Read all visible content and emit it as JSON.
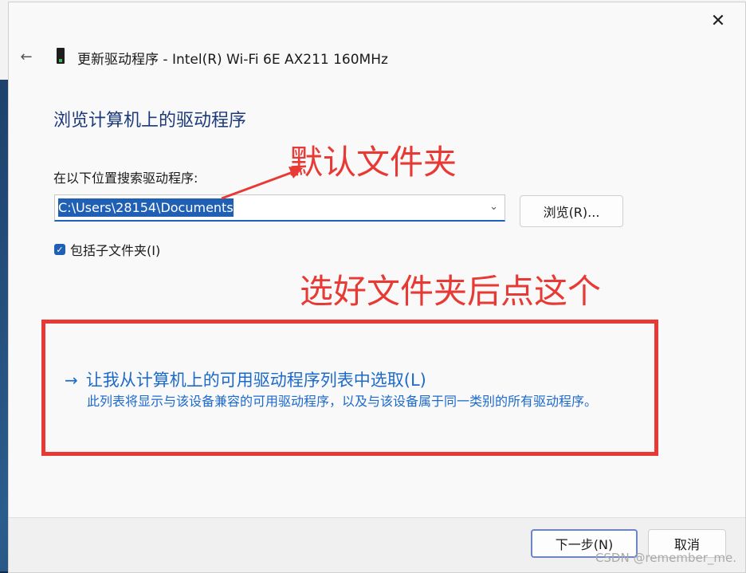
{
  "window": {
    "title": "更新驱动程序 - Intel(R) Wi-Fi 6E AX211 160MHz",
    "close_symbol": "✕",
    "back_symbol": "←"
  },
  "main": {
    "section_title": "浏览计算机上的驱动程序",
    "search_label": "在以下位置搜索驱动程序:",
    "path_value": "C:\\Users\\28154\\Documents",
    "browse_button": "浏览(R)...",
    "include_subfolders": {
      "label": "包括子文件夹(I)",
      "checked": true
    },
    "pick_from_list": {
      "arrow": "→",
      "label": "让我从计算机上的可用驱动程序列表中选取(L)",
      "description": "此列表将显示与该设备兼容的可用驱动程序，以及与该设备属于同一类别的所有驱动程序。"
    }
  },
  "annotations": {
    "default_folder": "默认文件夹",
    "after_select": "选好文件夹后点这个"
  },
  "footer": {
    "next_button": "下一步(N)",
    "cancel_button": "取消"
  },
  "watermark": "CSDN @remember_me.",
  "icons": {
    "back": "back-arrow-icon",
    "device": "network-adapter-icon",
    "close": "close-icon",
    "dropdown": "chevron-down-icon",
    "checkbox": "checkbox-checked-icon"
  },
  "colors": {
    "accent_blue": "#1f5fb4",
    "link_blue": "#1c6acb",
    "annotation_red": "#e83a35",
    "title_blue": "#1c3a7a"
  }
}
